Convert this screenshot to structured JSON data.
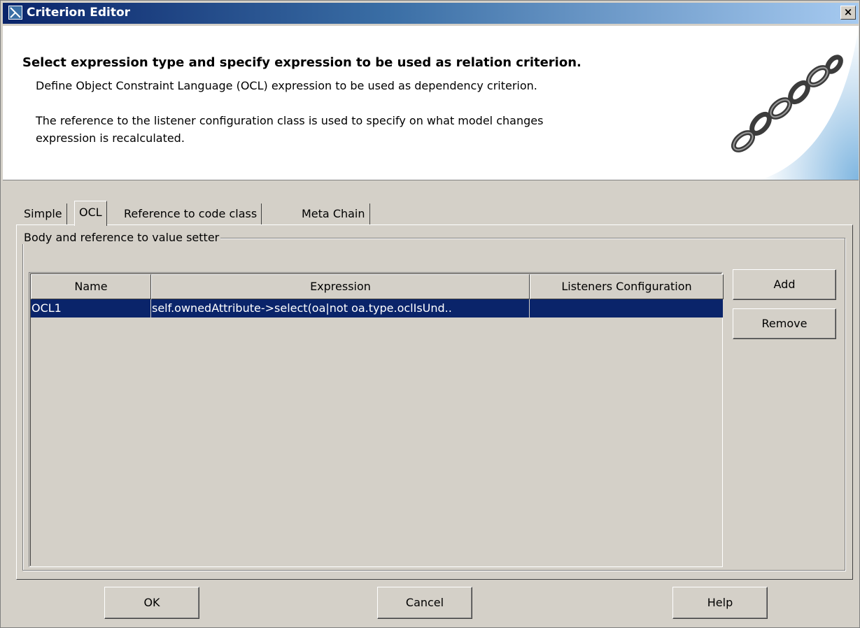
{
  "window": {
    "title": "Criterion Editor",
    "close_label": "×"
  },
  "header": {
    "title": "Select expression type and specify expression to be used as relation criterion.",
    "line1": "Define Object Constraint Language (OCL) expression to be used as dependency criterion.",
    "line2": "The reference to the listener configuration class is used to specify on what model changes",
    "line3": "expression is recalculated.",
    "image_icon": "chain-icon"
  },
  "tabs": [
    {
      "label": "Simple",
      "active": false
    },
    {
      "label": "OCL",
      "active": true
    },
    {
      "label": "Reference to code class",
      "active": false
    },
    {
      "label": "Meta Chain",
      "active": false
    }
  ],
  "group": {
    "legend": "Body and reference to value setter"
  },
  "table": {
    "columns": [
      "Name",
      "Expression",
      "Listeners Configuration"
    ],
    "rows": [
      {
        "name": "OCL1",
        "expression": "self.ownedAttribute->select(oa|not oa.type.oclIsUnd..",
        "listeners": "",
        "selected": true
      }
    ]
  },
  "side_buttons": {
    "add": "Add",
    "remove": "Remove"
  },
  "footer_buttons": {
    "ok": "OK",
    "cancel": "Cancel",
    "help": "Help"
  },
  "colors": {
    "selection": "#0a246a",
    "face": "#d4d0c8",
    "title_start": "#0a246a",
    "title_end": "#a6caf0"
  }
}
